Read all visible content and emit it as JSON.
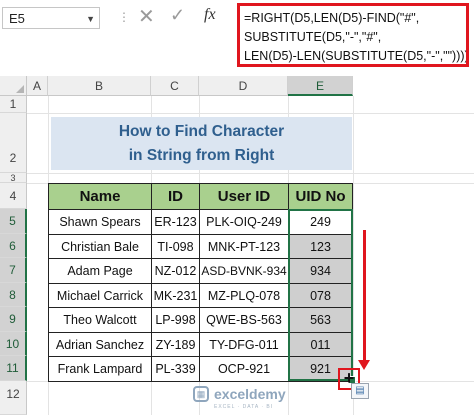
{
  "formula_bar": {
    "name_box": "E5",
    "formula": "=RIGHT(D5,LEN(D5)-FIND(\"#\",\nSUBSTITUTE(D5,\"-\",\"#\",\nLEN(D5)-LEN(SUBSTITUTE(D5,\"-\",\"\")))))",
    "fx_label": "fx"
  },
  "columns": [
    "A",
    "B",
    "C",
    "D",
    "E"
  ],
  "rows": [
    "1",
    "2",
    "3",
    "4",
    "5",
    "6",
    "7",
    "8",
    "9",
    "10",
    "11",
    "12"
  ],
  "selected_column": "E",
  "title": {
    "line1": "How to Find Character",
    "line2": "in String from Right"
  },
  "table": {
    "headers": [
      "Name",
      "ID",
      "User ID",
      "UID No"
    ],
    "rows": [
      [
        "Shawn Spears",
        "ER-123",
        "PLK-OIQ-249",
        "249"
      ],
      [
        "Christian Bale",
        "TI-098",
        "MNK-PT-123",
        "123"
      ],
      [
        "Adam Page",
        "NZ-012",
        "ASD-BVNK-934",
        "934"
      ],
      [
        "Michael Carrick",
        "MK-231",
        "MZ-PLQ-078",
        "078"
      ],
      [
        "Theo Walcott",
        "LP-998",
        "QWE-BS-563",
        "563"
      ],
      [
        "Adrian Sanchez",
        "ZY-189",
        "TY-DFG-011",
        "011"
      ],
      [
        "Frank Lampard",
        "PL-339",
        "OCP-921",
        "921"
      ]
    ]
  },
  "watermark": {
    "brand": "exceldemy",
    "tagline": "EXCEL · DATA · BI"
  },
  "colors": {
    "accent_green": "#217346",
    "header_fill": "#a9d08e",
    "title_fill": "#dbe5f1",
    "highlight_red": "#e0161e"
  }
}
